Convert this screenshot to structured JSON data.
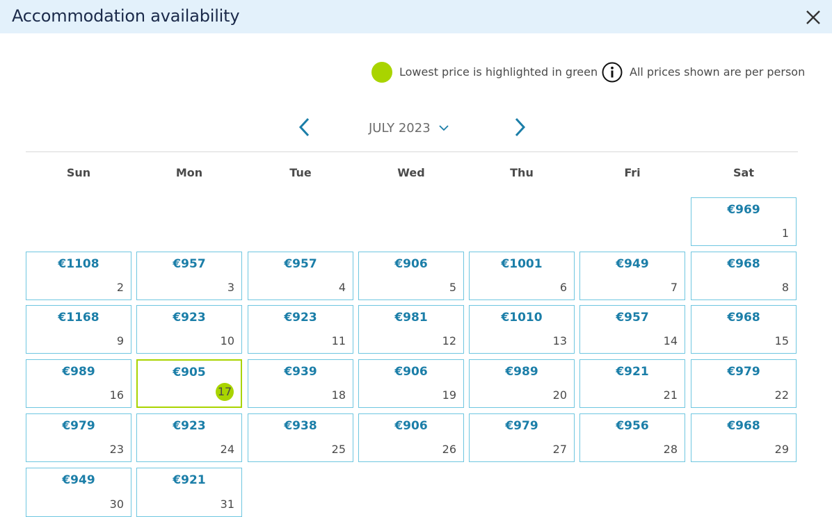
{
  "dialog": {
    "title": "Accommodation availability",
    "close_icon": "close-icon"
  },
  "legend": {
    "lowest_price_text": "Lowest price is highlighted in green",
    "lowest_price_color": "#a9d400",
    "per_person_text": "All prices shown are per person",
    "info_icon": "info-icon"
  },
  "calendar": {
    "month_label": "JULY 2023",
    "prev_icon": "chevron-left-icon",
    "next_icon": "chevron-right-icon",
    "dropdown_icon": "chevron-down-icon",
    "days_of_week": [
      "Sun",
      "Mon",
      "Tue",
      "Wed",
      "Thu",
      "Fri",
      "Sat"
    ],
    "price_color": "#1b7ea8",
    "cell_border_color": "#6ec6e0",
    "days": [
      {
        "day": "1",
        "price": "€969"
      },
      {
        "day": "2",
        "price": "€1108"
      },
      {
        "day": "3",
        "price": "€957"
      },
      {
        "day": "4",
        "price": "€957"
      },
      {
        "day": "5",
        "price": "€906"
      },
      {
        "day": "6",
        "price": "€1001"
      },
      {
        "day": "7",
        "price": "€949"
      },
      {
        "day": "8",
        "price": "€968"
      },
      {
        "day": "9",
        "price": "€1168"
      },
      {
        "day": "10",
        "price": "€923"
      },
      {
        "day": "11",
        "price": "€923"
      },
      {
        "day": "12",
        "price": "€981"
      },
      {
        "day": "13",
        "price": "€1010"
      },
      {
        "day": "14",
        "price": "€957"
      },
      {
        "day": "15",
        "price": "€968"
      },
      {
        "day": "16",
        "price": "€989"
      },
      {
        "day": "17",
        "price": "€905",
        "lowest": true
      },
      {
        "day": "18",
        "price": "€939"
      },
      {
        "day": "19",
        "price": "€906"
      },
      {
        "day": "20",
        "price": "€989"
      },
      {
        "day": "21",
        "price": "€921"
      },
      {
        "day": "22",
        "price": "€979"
      },
      {
        "day": "23",
        "price": "€979"
      },
      {
        "day": "24",
        "price": "€923"
      },
      {
        "day": "25",
        "price": "€938"
      },
      {
        "day": "26",
        "price": "€906"
      },
      {
        "day": "27",
        "price": "€979"
      },
      {
        "day": "28",
        "price": "€956"
      },
      {
        "day": "29",
        "price": "€968"
      },
      {
        "day": "30",
        "price": "€949"
      },
      {
        "day": "31",
        "price": "€921"
      }
    ]
  }
}
